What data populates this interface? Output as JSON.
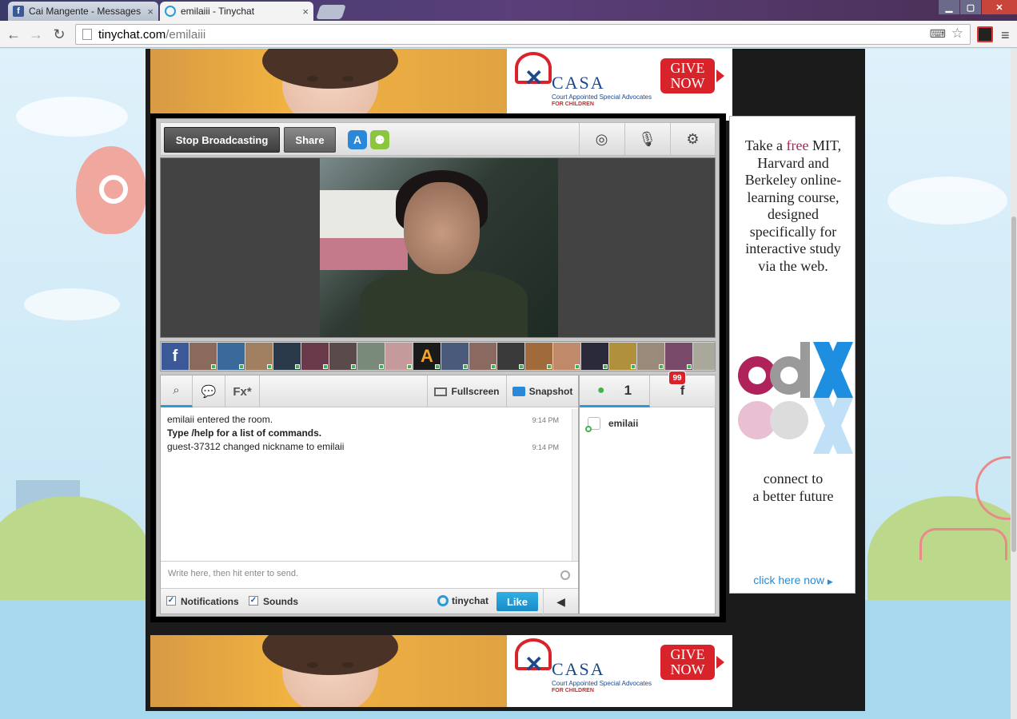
{
  "browser": {
    "tabs": [
      {
        "title": "Cai Mangente - Messages",
        "icon": "facebook-icon"
      },
      {
        "title": "emilaiii - Tinychat",
        "icon": "tinychat-icon"
      }
    ],
    "close_glyph": "×",
    "url_host": "tinychat.com",
    "url_path": "/emilaiii"
  },
  "ad_banner": {
    "brand": "CASA",
    "tagline": "Court Appointed Special Advocates",
    "tagline2": "FOR CHILDREN",
    "cta": "GIVE NOW"
  },
  "tinychat": {
    "toolbar": {
      "stop_broadcasting": "Stop Broadcasting",
      "share": "Share"
    },
    "chat_tabs": {
      "fx": "Fx*",
      "fullscreen": "Fullscreen",
      "snapshot": "Snapshot"
    },
    "messages": [
      {
        "text": "emilaii entered the room.",
        "time": "9:14 PM",
        "bold": false
      },
      {
        "text": "Type /help for a list of commands.",
        "time": "",
        "bold": true
      },
      {
        "text": "guest-37312 changed nickname to emilaii",
        "time": "9:14 PM",
        "bold": false
      }
    ],
    "input_placeholder": "Write here, then hit enter to send.",
    "footer": {
      "notifications": "Notifications",
      "sounds": "Sounds",
      "brand": "tinychat",
      "like": "Like"
    },
    "users_tab": {
      "count": "1",
      "fb_badge": "99"
    },
    "users": [
      "emilaii"
    ]
  },
  "edx_ad": {
    "text_before": "Take a ",
    "text_free": "free",
    "text_after": "MIT, Harvard and Berkeley online-learning course, designed specifically for interactive study via the web.",
    "tagline_1": "connect to",
    "tagline_2": "a better future",
    "link": "click here now"
  },
  "colors": {
    "accent": "#2a9bd6",
    "facebook": "#3b5998",
    "online": "#3db54a",
    "casa_red": "#d8232a",
    "edx_pink": "#b0225a"
  }
}
